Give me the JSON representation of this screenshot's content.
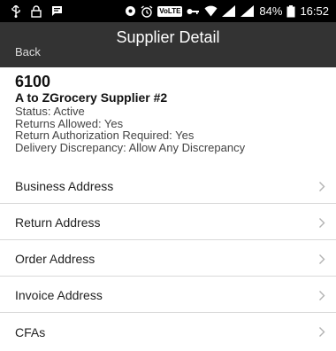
{
  "status_bar": {
    "battery": "84%",
    "time": "16:52",
    "volte_label": "VoLTE",
    "icons": [
      "usb-icon",
      "lock-icon",
      "message-icon",
      "nfc-icon",
      "alarm-icon",
      "volte-icon",
      "key-icon",
      "wifi-icon",
      "signal-icon",
      "signal-icon",
      "battery-icon"
    ]
  },
  "header": {
    "back_label": "Back",
    "title": "Supplier Detail"
  },
  "supplier": {
    "id": "6100",
    "name": "A to ZGrocery Supplier #2",
    "status": "Status: Active",
    "returns_allowed": "Returns Allowed: Yes",
    "return_auth": "Return Authorization Required: Yes",
    "delivery_discrepancy": "Delivery Discrepancy: Allow Any Discrepancy"
  },
  "menu": {
    "items": [
      {
        "label": "Business Address"
      },
      {
        "label": "Return Address"
      },
      {
        "label": "Order Address"
      },
      {
        "label": "Invoice Address"
      },
      {
        "label": "CFAs"
      }
    ]
  },
  "colors": {
    "app_bar": "#333333",
    "status_bar": "#000000",
    "divider": "#d9d9d9",
    "chevron": "#b3b3b3"
  }
}
